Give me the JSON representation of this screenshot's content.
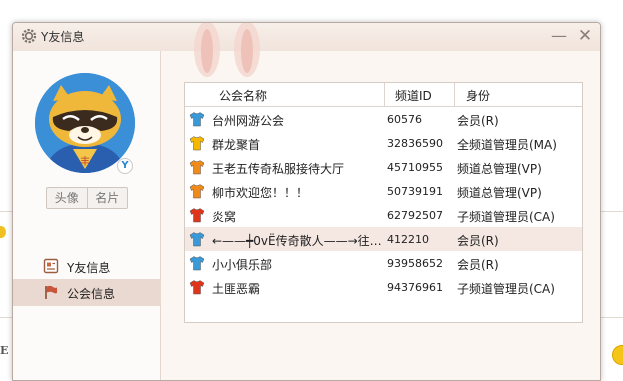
{
  "window": {
    "title": "Y友信息"
  },
  "avatar": {
    "badge_glyph": "Y",
    "badge_icon": "yy-badge-icon"
  },
  "profile_tabs": {
    "avatar_label": "头像",
    "card_label": "名片"
  },
  "nav": {
    "items": [
      {
        "label": "Y友信息",
        "icon": "profile-card-icon"
      },
      {
        "label": "公会信息",
        "icon": "guild-flag-icon",
        "selected": true
      }
    ]
  },
  "table": {
    "headers": {
      "name": "公会名称",
      "id": "频道ID",
      "role": "身份"
    },
    "rows": [
      {
        "icon_color": "#3a9ad9",
        "name": "台州网游公会",
        "id": "60576",
        "role": "会员(R)"
      },
      {
        "icon_color": "#f5b800",
        "name": "群龙聚首",
        "id": "32836590",
        "role": "全频道管理员(MA)"
      },
      {
        "icon_color": "#f08a1a",
        "name": "王老五传奇私服接待大厅",
        "id": "45710955",
        "role": "频道总管理(VP)"
      },
      {
        "icon_color": "#f08a1a",
        "name": "柳市欢迎您！！！",
        "id": "50739191",
        "role": "频道总管理(VP)"
      },
      {
        "icon_color": "#e0341c",
        "name": "炎窝",
        "id": "62792507",
        "role": "子频道管理员(CA)"
      },
      {
        "icon_color": "#3a9ad9",
        "name": "←——┿0vЁ传奇散人——→往…",
        "id": "412210",
        "role": "会员(R)",
        "selected": true
      },
      {
        "icon_color": "#3a9ad9",
        "name": "小小俱乐部",
        "id": "93958652",
        "role": "会员(R)"
      },
      {
        "icon_color": "#e0341c",
        "name": "土匪恶霸",
        "id": "94376961",
        "role": "子频道管理员(CA)"
      }
    ]
  },
  "background": {
    "letter": "E"
  }
}
